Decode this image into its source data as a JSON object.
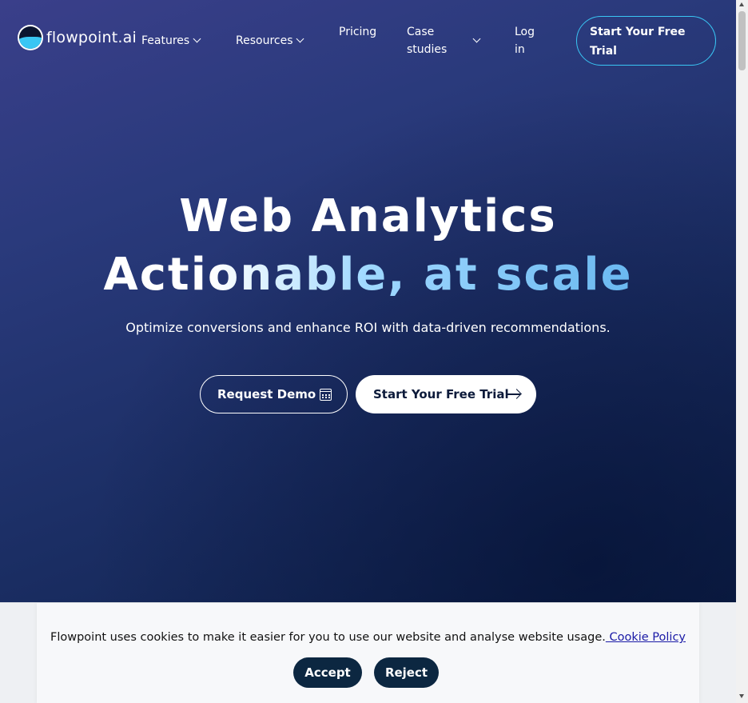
{
  "header": {
    "logo_text": "flowpoint.ai",
    "nav": {
      "features": "Features",
      "resources": "Resources",
      "pricing": "Pricing",
      "case_studies_line1": "Case",
      "case_studies_line2": "studies",
      "login_line1": "Log",
      "login_line2": "in"
    },
    "cta_line1": "Start Your Free",
    "cta_line2": "Trial"
  },
  "hero": {
    "title_line1": "Web Analytics",
    "title_line2": "Actionable, at scale",
    "subtitle": "Optimize conversions and enhance ROI with data-driven recommendations.",
    "request_demo_label": "Request Demo",
    "free_trial_label": "Start Your Free Trial"
  },
  "cookie_banner": {
    "message": "Flowpoint uses cookies to make it easier for you to use our website and analyse website usage.",
    "link_text": " Cookie Policy",
    "accept_label": "Accept",
    "reject_label": "Reject"
  },
  "colors": {
    "accent": "#39c6f4",
    "button_dark": "#0c2741"
  },
  "icons": [
    "logo-icon",
    "chevron-down-icon",
    "calendar-icon",
    "arrow-right-icon"
  ]
}
